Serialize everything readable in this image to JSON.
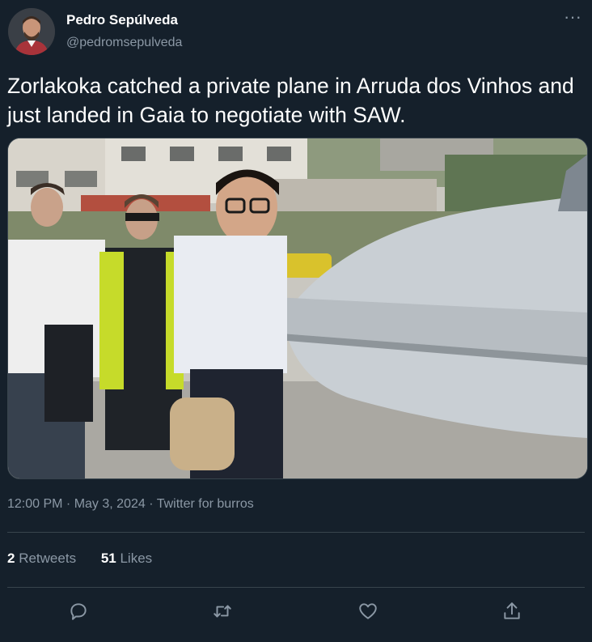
{
  "author": {
    "display_name": "Pedro Sepúlveda",
    "handle": "@pedromsepulveda"
  },
  "tweet": {
    "text": "Zorlakoka catched a private plane in Arruda dos Vinhos and just landed in Gaia to negotiate with SAW."
  },
  "meta": {
    "time": "12:00 PM",
    "sep1": " · ",
    "date": "May 3, 2024",
    "sep2": " · ",
    "source": "Twitter for burros"
  },
  "stats": {
    "retweets_count": "2",
    "retweets_label": "Retweets",
    "likes_count": "51",
    "likes_label": "Likes"
  },
  "more_glyph": "···",
  "icons": [
    "more-icon",
    "reply-icon",
    "retweet-icon",
    "like-icon",
    "share-icon"
  ],
  "colors": {
    "background": "#15202b",
    "secondary_text": "#8b98a5",
    "divider": "#38444d"
  }
}
